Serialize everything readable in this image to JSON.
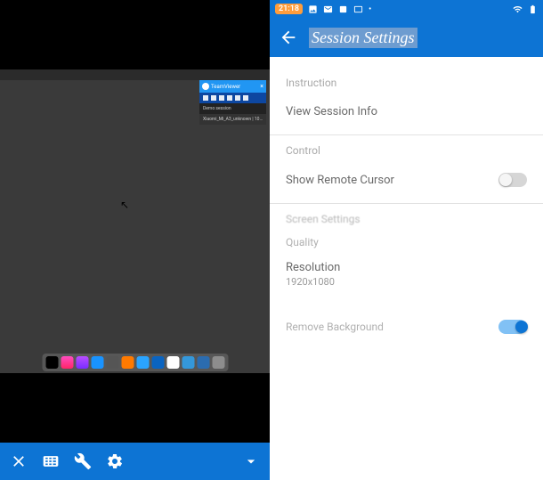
{
  "left": {
    "tv_title": "TeamViewer",
    "tv_session_label": "Demo session",
    "tv_tab_label": "Xiaomi_Mi_A3_unknown | 10…",
    "dock": [
      {
        "name": "apple-tv",
        "bg": "#000",
        "fg": "#fff"
      },
      {
        "name": "music",
        "bg": "linear-gradient(#ff4cc0,#ff2567)"
      },
      {
        "name": "podcasts",
        "bg": "linear-gradient(#b84dff,#7a2dff)"
      },
      {
        "name": "app-store",
        "bg": "#1993ff"
      },
      {
        "name": "settings",
        "bg": "#555"
      },
      {
        "name": "vlc",
        "bg": "#ff7a00"
      },
      {
        "name": "finder",
        "bg": "#2aa4ff"
      },
      {
        "name": "teamviewer",
        "bg": "#0a64c1"
      },
      {
        "name": "document",
        "bg": "#fff"
      },
      {
        "name": "mail",
        "bg": "#3498db"
      },
      {
        "name": "dropbox",
        "bg": "#2b6cb0"
      },
      {
        "name": "trash",
        "bg": "#8d8d8d"
      }
    ],
    "toolbar": {
      "close": "close",
      "keyboard": "keyboard",
      "wrench": "tools",
      "gear": "settings",
      "chevron": "expand"
    }
  },
  "right": {
    "status": {
      "time": "21:18"
    },
    "header": {
      "title": "Session Settings"
    },
    "sections": {
      "instruction_label": "Instruction",
      "view_session_info": "View Session Info",
      "control_label": "Control",
      "show_remote_cursor": "Show Remote Cursor",
      "screen_settings_label": "Screen Settings",
      "quality_label": "Quality",
      "resolution_label": "Resolution",
      "resolution_value": "1920x1080",
      "remove_background": "Remove Background"
    },
    "toggles": {
      "show_remote_cursor": false,
      "remove_background": true
    }
  }
}
